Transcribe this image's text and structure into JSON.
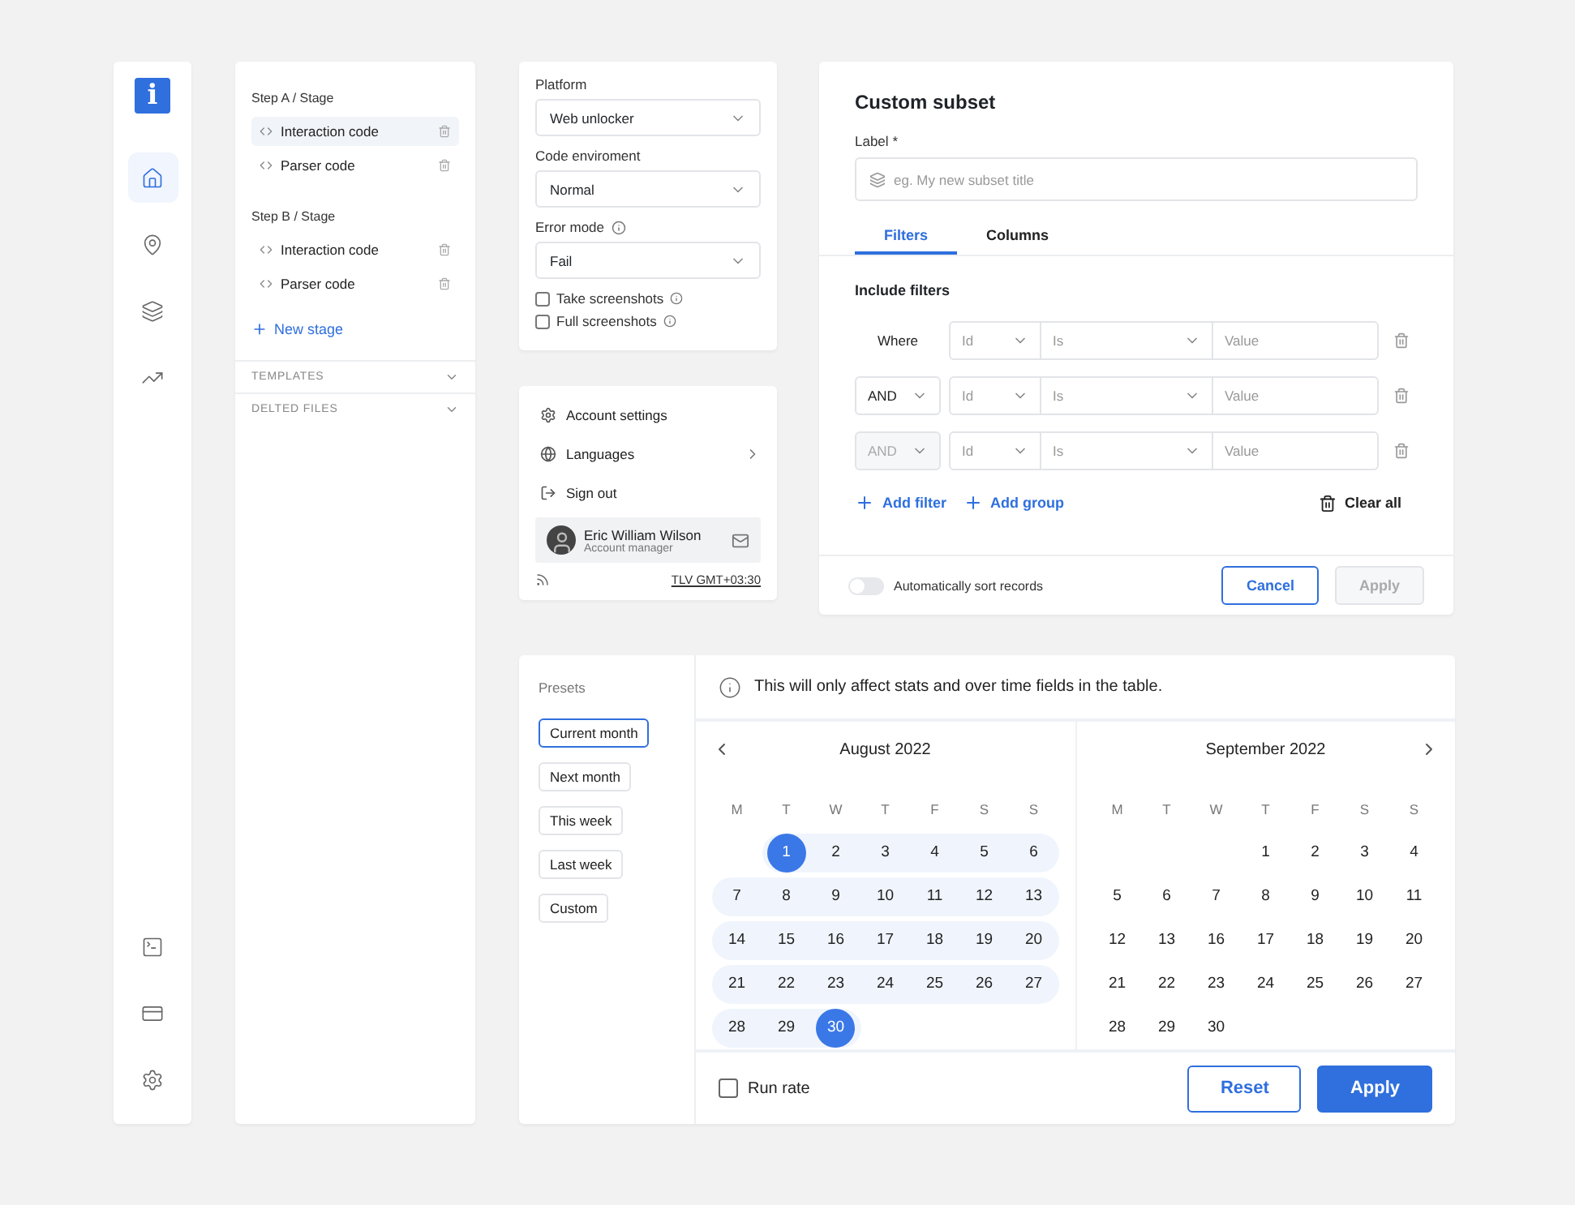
{
  "rail": {
    "logo": "i",
    "top": [
      {
        "kind": "home",
        "selected": true
      },
      {
        "kind": "pin",
        "selected": false
      },
      {
        "kind": "layers",
        "selected": false
      },
      {
        "kind": "chart",
        "selected": false
      }
    ],
    "bottom": [
      {
        "kind": "terminal",
        "selected": false
      },
      {
        "kind": "card",
        "selected": false
      },
      {
        "kind": "settings",
        "selected": false
      }
    ]
  },
  "stages": {
    "groups": [
      {
        "title": "Step A / Stage",
        "items": [
          {
            "label": "Interaction code",
            "selected": true
          },
          {
            "label": "Parser code",
            "selected": false
          }
        ]
      },
      {
        "title": "Step B / Stage",
        "items": [
          {
            "label": "Interaction code",
            "selected": false
          },
          {
            "label": "Parser code",
            "selected": false
          }
        ]
      }
    ],
    "new_stage": "New stage",
    "sections": [
      {
        "label": "TEMPLATES",
        "expanded": false
      },
      {
        "label": "DELTED FILES",
        "expanded": false
      }
    ]
  },
  "settings": {
    "fields": [
      {
        "label": "Platform",
        "value": "Web unlocker",
        "info": false
      },
      {
        "label": "Code enviroment",
        "value": "Normal",
        "info": false
      },
      {
        "label": "Error mode",
        "value": "Fail",
        "info": true
      }
    ],
    "checkboxes": [
      {
        "label": "Take screenshots",
        "checked": false,
        "info": true
      },
      {
        "label": "Full screenshots",
        "checked": false,
        "info": true
      }
    ]
  },
  "account_menu": {
    "items": [
      {
        "kind": "settings",
        "label": "Account settings",
        "submenu": false
      },
      {
        "kind": "globe",
        "label": "Languages",
        "submenu": true
      },
      {
        "kind": "signout",
        "label": "Sign out",
        "submenu": false
      }
    ],
    "user": {
      "name": "Eric William Wilson",
      "role": "Account manager"
    },
    "timezone": "TLV GMT+03:30"
  },
  "subset": {
    "title": "Custom subset",
    "label": "Label",
    "required_mark": "*",
    "placeholder": "eg. My new subset title",
    "tabs": [
      {
        "label": "Filters",
        "selected": true
      },
      {
        "label": "Columns",
        "selected": false
      }
    ],
    "section": "Include filters",
    "rows": [
      {
        "connector": {
          "kind": "label",
          "text": "Where"
        },
        "field": "Id",
        "operator": "Is",
        "value_placeholder": "Value"
      },
      {
        "connector": {
          "kind": "select",
          "text": "AND",
          "disabled": false
        },
        "field": "Id",
        "operator": "Is",
        "value_placeholder": "Value"
      },
      {
        "connector": {
          "kind": "select",
          "text": "AND",
          "disabled": true
        },
        "field": "Id",
        "operator": "Is",
        "value_placeholder": "Value"
      }
    ],
    "add_filter": "Add filter",
    "add_group": "Add group",
    "clear_all": "Clear all",
    "toggle": {
      "label": "Automatically sort records",
      "on": false
    },
    "cancel": "Cancel",
    "apply": {
      "label": "Apply",
      "disabled": true
    }
  },
  "calendar": {
    "presets_title": "Presets",
    "presets": [
      {
        "label": "Current month",
        "selected": true
      },
      {
        "label": "Next month",
        "selected": false
      },
      {
        "label": "This week",
        "selected": false
      },
      {
        "label": "Last week",
        "selected": false
      },
      {
        "label": "Custom",
        "selected": false
      }
    ],
    "notice": "This will only affect stats and over time fields in the table.",
    "months": [
      {
        "title": "August 2022",
        "weekdays": [
          "M",
          "T",
          "W",
          "T",
          "F",
          "S",
          "S"
        ],
        "weeks": [
          [
            {
              "kind": "empty"
            },
            {
              "kind": "day",
              "day": "1",
              "selected": true,
              "in_range": true
            },
            {
              "kind": "day",
              "day": "2",
              "selected": false,
              "in_range": true
            },
            {
              "kind": "day",
              "day": "3",
              "selected": false,
              "in_range": true
            },
            {
              "kind": "day",
              "day": "4",
              "selected": false,
              "in_range": true
            },
            {
              "kind": "day",
              "day": "5",
              "selected": false,
              "in_range": true
            },
            {
              "kind": "day",
              "day": "6",
              "selected": false,
              "in_range": true
            }
          ],
          [
            {
              "kind": "day",
              "day": "7",
              "selected": false,
              "in_range": true
            },
            {
              "kind": "day",
              "day": "8",
              "selected": false,
              "in_range": true
            },
            {
              "kind": "day",
              "day": "9",
              "selected": false,
              "in_range": true
            },
            {
              "kind": "day",
              "day": "10",
              "selected": false,
              "in_range": true
            },
            {
              "kind": "day",
              "day": "11",
              "selected": false,
              "in_range": true
            },
            {
              "kind": "day",
              "day": "12",
              "selected": false,
              "in_range": true
            },
            {
              "kind": "day",
              "day": "13",
              "selected": false,
              "in_range": true
            }
          ],
          [
            {
              "kind": "day",
              "day": "14",
              "selected": false,
              "in_range": true
            },
            {
              "kind": "day",
              "day": "15",
              "selected": false,
              "in_range": true
            },
            {
              "kind": "day",
              "day": "16",
              "selected": false,
              "in_range": true
            },
            {
              "kind": "day",
              "day": "17",
              "selected": false,
              "in_range": true
            },
            {
              "kind": "day",
              "day": "18",
              "selected": false,
              "in_range": true
            },
            {
              "kind": "day",
              "day": "19",
              "selected": false,
              "in_range": true
            },
            {
              "kind": "day",
              "day": "20",
              "selected": false,
              "in_range": true
            }
          ],
          [
            {
              "kind": "day",
              "day": "21",
              "selected": false,
              "in_range": true
            },
            {
              "kind": "day",
              "day": "22",
              "selected": false,
              "in_range": true
            },
            {
              "kind": "day",
              "day": "23",
              "selected": false,
              "in_range": true
            },
            {
              "kind": "day",
              "day": "24",
              "selected": false,
              "in_range": true
            },
            {
              "kind": "day",
              "day": "25",
              "selected": false,
              "in_range": true
            },
            {
              "kind": "day",
              "day": "26",
              "selected": false,
              "in_range": true
            },
            {
              "kind": "day",
              "day": "27",
              "selected": false,
              "in_range": true
            }
          ],
          [
            {
              "kind": "day",
              "day": "28",
              "selected": false,
              "in_range": true
            },
            {
              "kind": "day",
              "day": "29",
              "selected": false,
              "in_range": true
            },
            {
              "kind": "day",
              "day": "30",
              "selected": true,
              "in_range": true
            }
          ]
        ]
      },
      {
        "title": "September 2022",
        "weekdays": [
          "M",
          "T",
          "W",
          "T",
          "F",
          "S",
          "S"
        ],
        "weeks": [
          [
            {
              "kind": "empty"
            },
            {
              "kind": "empty"
            },
            {
              "kind": "empty"
            },
            {
              "kind": "day",
              "day": "1",
              "selected": false,
              "in_range": false
            },
            {
              "kind": "day",
              "day": "2",
              "selected": false,
              "in_range": false
            },
            {
              "kind": "day",
              "day": "3",
              "selected": false,
              "in_range": false
            },
            {
              "kind": "day",
              "day": "4",
              "selected": false,
              "in_range": false
            }
          ],
          [
            {
              "kind": "day",
              "day": "5",
              "selected": false,
              "in_range": false
            },
            {
              "kind": "day",
              "day": "6",
              "selected": false,
              "in_range": false
            },
            {
              "kind": "day",
              "day": "7",
              "selected": false,
              "in_range": false
            },
            {
              "kind": "day",
              "day": "8",
              "selected": false,
              "in_range": false
            },
            {
              "kind": "day",
              "day": "9",
              "selected": false,
              "in_range": false
            },
            {
              "kind": "day",
              "day": "10",
              "selected": false,
              "in_range": false
            },
            {
              "kind": "day",
              "day": "11",
              "selected": false,
              "in_range": false
            }
          ],
          [
            {
              "kind": "day",
              "day": "12",
              "selected": false,
              "in_range": false
            },
            {
              "kind": "day",
              "day": "13",
              "selected": false,
              "in_range": false
            },
            {
              "kind": "day",
              "day": "16",
              "selected": false,
              "in_range": false
            },
            {
              "kind": "day",
              "day": "17",
              "selected": false,
              "in_range": false
            },
            {
              "kind": "day",
              "day": "18",
              "selected": false,
              "in_range": false
            },
            {
              "kind": "day",
              "day": "19",
              "selected": false,
              "in_range": false
            },
            {
              "kind": "day",
              "day": "20",
              "selected": false,
              "in_range": false
            }
          ],
          [
            {
              "kind": "day",
              "day": "21",
              "selected": false,
              "in_range": false
            },
            {
              "kind": "day",
              "day": "22",
              "selected": false,
              "in_range": false
            },
            {
              "kind": "day",
              "day": "23",
              "selected": false,
              "in_range": false
            },
            {
              "kind": "day",
              "day": "24",
              "selected": false,
              "in_range": false
            },
            {
              "kind": "day",
              "day": "25",
              "selected": false,
              "in_range": false
            },
            {
              "kind": "day",
              "day": "26",
              "selected": false,
              "in_range": false
            },
            {
              "kind": "day",
              "day": "27",
              "selected": false,
              "in_range": false
            }
          ],
          [
            {
              "kind": "day",
              "day": "28",
              "selected": false,
              "in_range": false
            },
            {
              "kind": "day",
              "day": "29",
              "selected": false,
              "in_range": false
            },
            {
              "kind": "day",
              "day": "30",
              "selected": false,
              "in_range": false
            }
          ]
        ]
      }
    ],
    "run_rate": {
      "label": "Run rate",
      "checked": false
    },
    "reset": "Reset",
    "apply": "Apply"
  }
}
